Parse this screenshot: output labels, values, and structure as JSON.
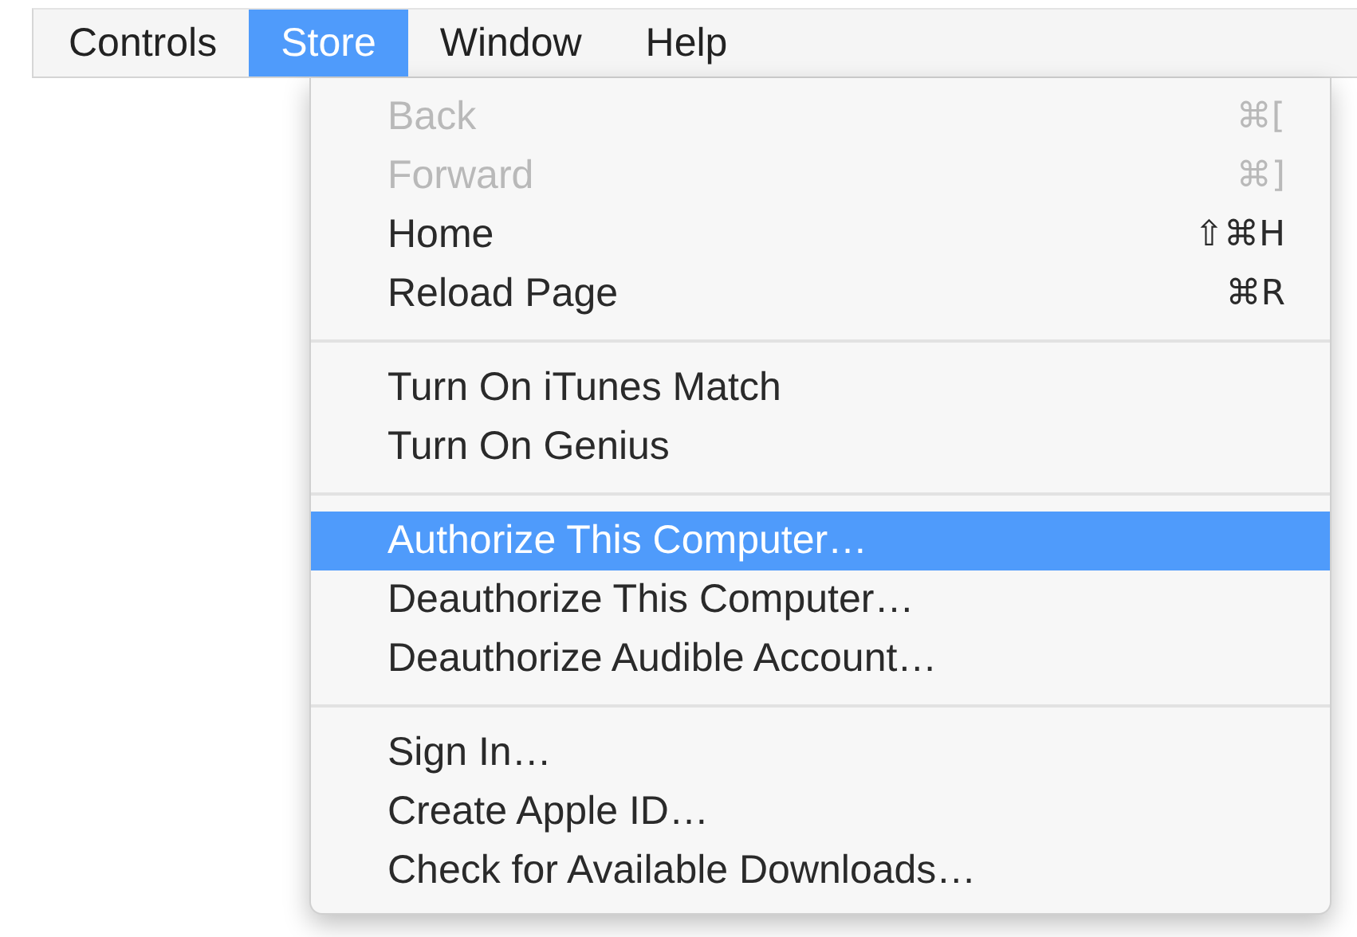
{
  "menubar": {
    "items": [
      {
        "label": "Controls",
        "selected": false
      },
      {
        "label": "Store",
        "selected": true
      },
      {
        "label": "Window",
        "selected": false
      },
      {
        "label": "Help",
        "selected": false
      }
    ]
  },
  "menu": {
    "groups": [
      [
        {
          "label": "Back",
          "shortcut": "⌘[",
          "disabled": true,
          "selected": false
        },
        {
          "label": "Forward",
          "shortcut": "⌘]",
          "disabled": true,
          "selected": false
        },
        {
          "label": "Home",
          "shortcut": "⇧⌘H",
          "disabled": false,
          "selected": false
        },
        {
          "label": "Reload Page",
          "shortcut": "⌘R",
          "disabled": false,
          "selected": false
        }
      ],
      [
        {
          "label": "Turn On iTunes Match",
          "disabled": false,
          "selected": false
        },
        {
          "label": "Turn On Genius",
          "disabled": false,
          "selected": false
        }
      ],
      [
        {
          "label": "Authorize This Computer…",
          "disabled": false,
          "selected": true
        },
        {
          "label": "Deauthorize This Computer…",
          "disabled": false,
          "selected": false
        },
        {
          "label": "Deauthorize Audible Account…",
          "disabled": false,
          "selected": false
        }
      ],
      [
        {
          "label": "Sign In…",
          "disabled": false,
          "selected": false
        },
        {
          "label": "Create Apple ID…",
          "disabled": false,
          "selected": false
        },
        {
          "label": "Check for Available Downloads…",
          "disabled": false,
          "selected": false
        }
      ]
    ]
  }
}
